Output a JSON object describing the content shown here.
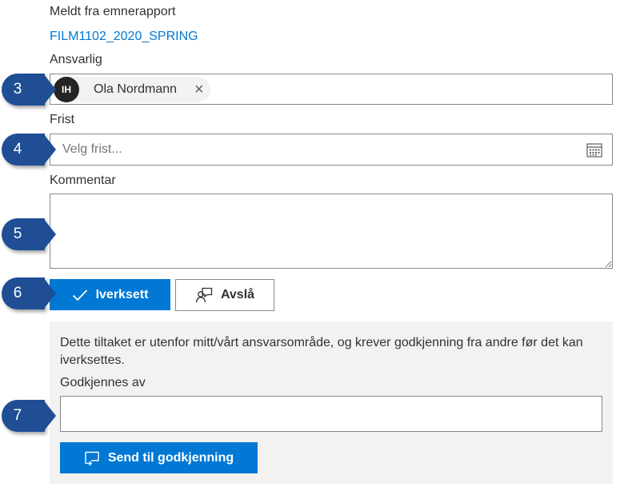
{
  "source": {
    "label": "Meldt fra emnerapport",
    "link": "FILM1102_2020_SPRING"
  },
  "responsible": {
    "label": "Ansvarlig",
    "persona_initials": "IH",
    "persona_name": "Ola Nordmann",
    "remove_icon": "×"
  },
  "deadline": {
    "label": "Frist",
    "placeholder": "Velg frist..."
  },
  "comment": {
    "label": "Kommentar",
    "value": ""
  },
  "actions": {
    "implement_label": "Iverksett",
    "reject_label": "Avslå"
  },
  "approval": {
    "info_text": "Dette tiltaket er utenfor mitt/vårt ansvarsområde, og krever godkjenning fra andre før det kan iverksettes.",
    "approver_label": "Godkjennes av",
    "approver_value": "",
    "send_label": "Send til godkjenning"
  },
  "callouts": [
    "3",
    "4",
    "5",
    "6",
    "7"
  ],
  "colors": {
    "accent": "#0078d4",
    "callout": "#1f4e95",
    "panel": "#f3f2f1",
    "border": "#8a8886"
  }
}
